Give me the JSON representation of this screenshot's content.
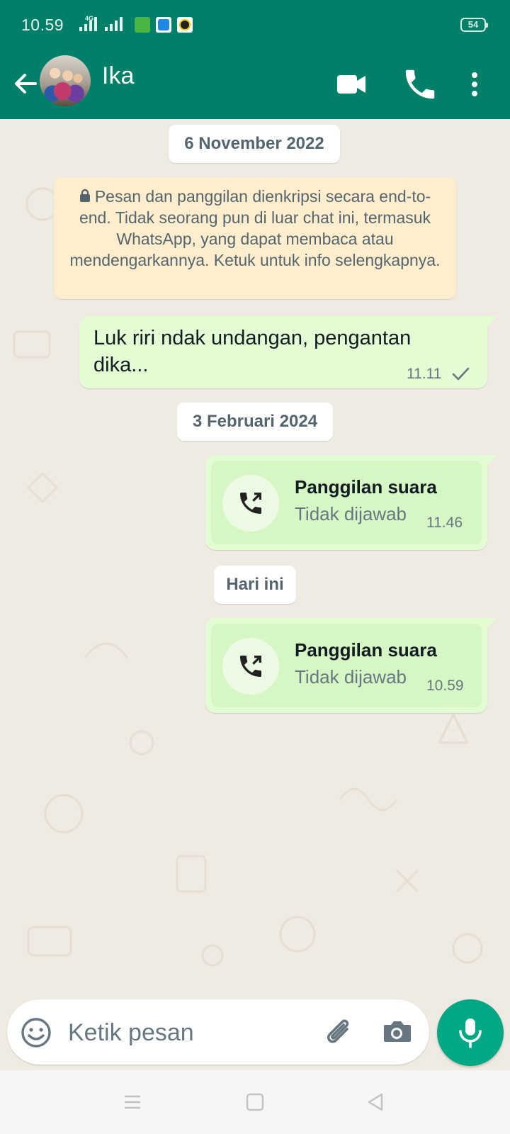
{
  "status_bar": {
    "time": "10.59",
    "network": "4G",
    "battery": "54"
  },
  "header": {
    "contact_name": "Ika",
    "icons": [
      "back-arrow-icon",
      "video-call-icon",
      "voice-call-icon",
      "more-options-icon"
    ]
  },
  "chat": {
    "date_1": "6 November 2022",
    "encryption_notice": "Pesan dan panggilan dienkripsi secara end-to-end. Tidak seorang pun di luar chat ini, termasuk WhatsApp, yang dapat membaca atau mendengarkannya. Ketuk untuk info selengkapnya.",
    "msg_1": {
      "text": "Luk riri ndak undangan, pengantan dika...",
      "time": "11.11",
      "status": "sent-single-check"
    },
    "date_2": "3 Februari 2024",
    "call_1": {
      "title": "Panggilan suara",
      "subtitle": "Tidak dijawab",
      "time": "11.46"
    },
    "date_3": "Hari ini",
    "call_2": {
      "title": "Panggilan suara",
      "subtitle": "Tidak dijawab",
      "time": "10.59"
    }
  },
  "composer": {
    "placeholder": "Ketik pesan",
    "icons": [
      "emoji-icon",
      "attach-icon",
      "camera-icon",
      "mic-icon"
    ]
  },
  "colors": {
    "header": "#008069",
    "outgoing_bubble": "#e3fcd3",
    "notice": "#ffeecd",
    "accent": "#00a884",
    "chat_bg": "#efeae2"
  }
}
